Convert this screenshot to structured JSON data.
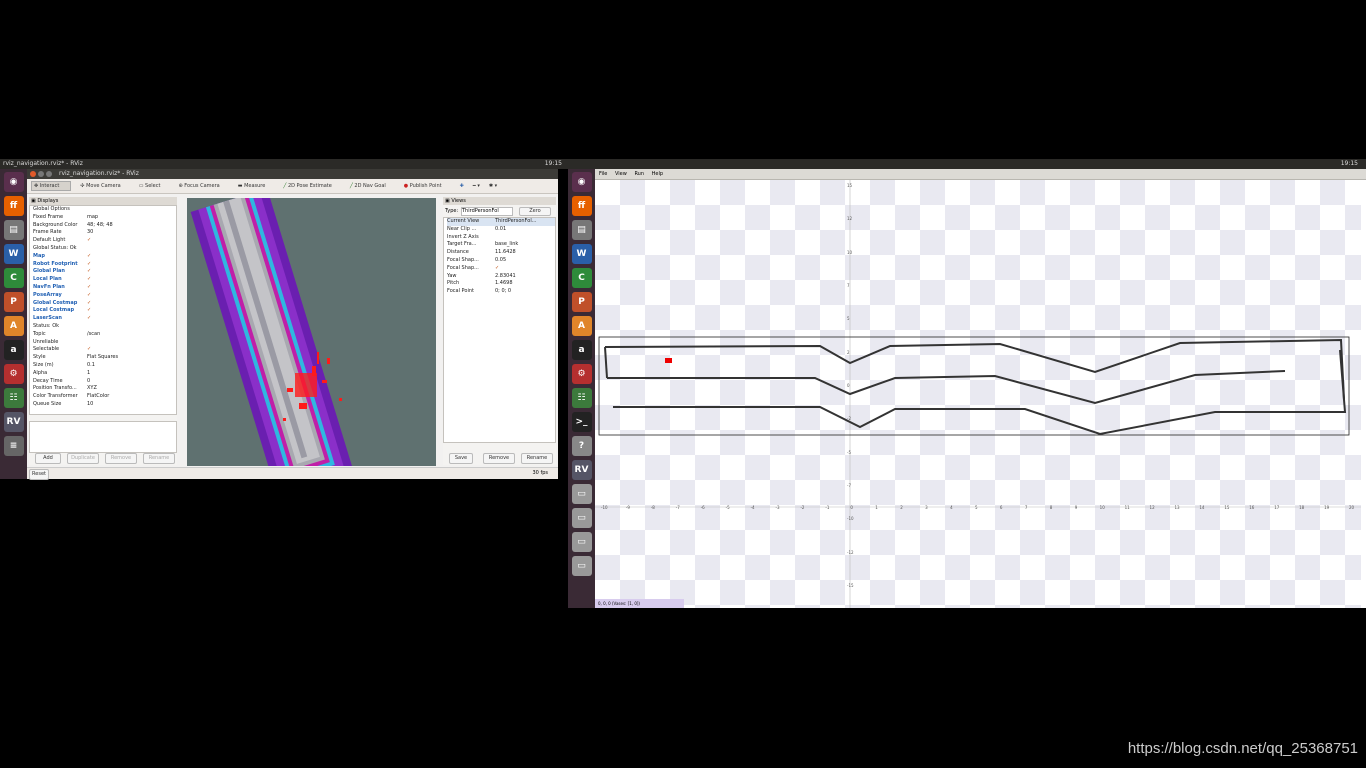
{
  "left_screen": {
    "top_panel": {
      "title": "rviz_navigation.rviz* - RViz",
      "time": "19:15"
    },
    "window_title": "rviz_navigation.rviz* - RViz",
    "toolbar": {
      "interact": "Interact",
      "move_camera": "Move Camera",
      "select": "Select",
      "focus_camera": "Focus Camera",
      "measure": "Measure",
      "pose_estimate": "2D Pose Estimate",
      "nav_goal": "2D Nav Goal",
      "publish_point": "Publish Point"
    },
    "displays": {
      "header": "Displays",
      "rows": [
        {
          "k": "Global Options",
          "v": "",
          "cls": ""
        },
        {
          "k": "Fixed Frame",
          "v": "map",
          "cls": ""
        },
        {
          "k": "Background Color",
          "v": "48; 48; 48",
          "cls": ""
        },
        {
          "k": "Frame Rate",
          "v": "30",
          "cls": ""
        },
        {
          "k": "Default Light",
          "v": "✓",
          "cls": ""
        },
        {
          "k": "Global Status: Ok",
          "v": "",
          "cls": ""
        },
        {
          "k": "Map",
          "v": "✓",
          "cls": "blue"
        },
        {
          "k": "Robot Footprint",
          "v": "✓",
          "cls": "blue"
        },
        {
          "k": "Global Plan",
          "v": "✓",
          "cls": "blue"
        },
        {
          "k": "Local Plan",
          "v": "✓",
          "cls": "blue"
        },
        {
          "k": "NavFn Plan",
          "v": "✓",
          "cls": "blue"
        },
        {
          "k": "PoseArray",
          "v": "✓",
          "cls": "blue"
        },
        {
          "k": "Global Costmap",
          "v": "✓",
          "cls": "blue"
        },
        {
          "k": "Local Costmap",
          "v": "✓",
          "cls": "blue"
        },
        {
          "k": "LaserScan",
          "v": "✓",
          "cls": "blue"
        },
        {
          "k": "Status: Ok",
          "v": "",
          "cls": ""
        },
        {
          "k": "Topic",
          "v": "/scan",
          "cls": ""
        },
        {
          "k": "Unreliable",
          "v": "",
          "cls": ""
        },
        {
          "k": "Selectable",
          "v": "✓",
          "cls": ""
        },
        {
          "k": "Style",
          "v": "Flat Squares",
          "cls": ""
        },
        {
          "k": "Size (m)",
          "v": "0.1",
          "cls": ""
        },
        {
          "k": "Alpha",
          "v": "1",
          "cls": ""
        },
        {
          "k": "Decay Time",
          "v": "0",
          "cls": ""
        },
        {
          "k": "Position Transfo...",
          "v": "XYZ",
          "cls": ""
        },
        {
          "k": "Color Transformer",
          "v": "FlatColor",
          "cls": ""
        },
        {
          "k": "Queue Size",
          "v": "10",
          "cls": ""
        }
      ],
      "buttons": {
        "add": "Add",
        "duplicate": "Duplicate",
        "remove": "Remove",
        "rename": "Rename"
      }
    },
    "views": {
      "header": "Views",
      "type_label": "Type:",
      "type_value": "ThirdPersonFol",
      "zero": "Zero",
      "rows": [
        {
          "k": "Current View",
          "v": "ThirdPersonFol..."
        },
        {
          "k": "Near Clip ...",
          "v": "0.01"
        },
        {
          "k": "Invert Z Axis",
          "v": ""
        },
        {
          "k": "Target Fra...",
          "v": "base_link"
        },
        {
          "k": "Distance",
          "v": "11.6428"
        },
        {
          "k": "Focal Shap...",
          "v": "0.05"
        },
        {
          "k": "Focal Shap...",
          "v": "✓"
        },
        {
          "k": "Yaw",
          "v": "2.83041"
        },
        {
          "k": "Pitch",
          "v": "1.4698"
        },
        {
          "k": "Focal Point",
          "v": "0; 0; 0"
        }
      ],
      "buttons": {
        "save": "Save",
        "remove": "Remove",
        "rename": "Rename"
      }
    },
    "status": {
      "reset": "Reset",
      "fps": "30 fps"
    }
  },
  "right_screen": {
    "top_panel": {
      "time": "19:15"
    },
    "menu": {
      "file": "File",
      "view": "View",
      "run": "Run",
      "help": "Help"
    },
    "plot": {
      "x_ticks": [
        "-10",
        "-9",
        "-8",
        "-7",
        "-6",
        "-5",
        "-4",
        "-3",
        "-2",
        "-1",
        "0",
        "1",
        "2",
        "3",
        "4",
        "5",
        "6",
        "7",
        "8",
        "9",
        "10",
        "11",
        "12",
        "13",
        "14",
        "15",
        "16",
        "17",
        "18",
        "19",
        "20"
      ],
      "y_ticks": [
        "15",
        "12",
        "10",
        "7",
        "5",
        "2",
        "0",
        "-2",
        "-5",
        "-7",
        "-10",
        "-12",
        "-15"
      ]
    },
    "status_text": "0, 0, 0 (Vases: [1, 0])"
  },
  "watermark": "https://blog.csdn.net/qq_25368751"
}
